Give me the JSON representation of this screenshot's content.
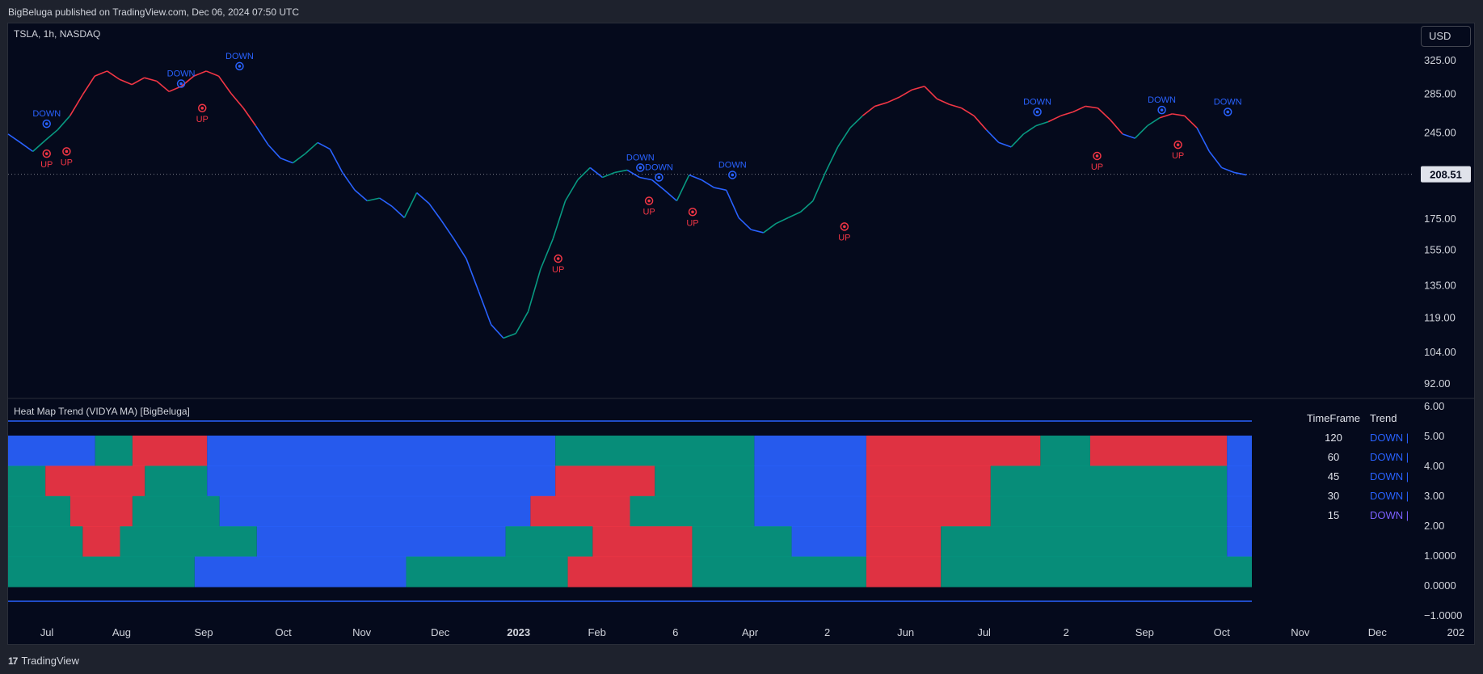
{
  "header": {
    "published": "BigBeluga published on TradingView.com, Dec 06, 2024 07:50 UTC"
  },
  "symbol_label": "TSLA, 1h, NASDAQ",
  "currency_button": "USD",
  "indicator_label": "Heat Map Trend (VIDYA MA) [BigBeluga]",
  "footer": {
    "brand": "TradingView",
    "logo_mark": "17"
  },
  "colors": {
    "up": "#f23645",
    "down": "#2962ff",
    "teal": "#089981",
    "background": "#050a1c",
    "panel": "#1e222d"
  },
  "trend_table": {
    "header_timeframe": "TimeFrame",
    "header_trend": "Trend",
    "rows": [
      {
        "timeframe": "120",
        "trend": "DOWN",
        "color": "#2962ff"
      },
      {
        "timeframe": "60",
        "trend": "DOWN",
        "color": "#2962ff"
      },
      {
        "timeframe": "45",
        "trend": "DOWN",
        "color": "#2962ff"
      },
      {
        "timeframe": "30",
        "trend": "DOWN",
        "color": "#2962ff"
      },
      {
        "timeframe": "15",
        "trend": "DOWN",
        "color": "#7b61ff"
      }
    ]
  },
  "chart_data": [
    {
      "type": "line",
      "title": "TSLA, 1h, NASDAQ",
      "y_ticks": [
        325.0,
        285.0,
        245.0,
        208.51,
        175.0,
        155.0,
        135.0,
        119.0,
        104.0,
        92.0
      ],
      "y_tick_labels": [
        "325.00",
        "285.00",
        "245.00",
        "208.51",
        "175.00",
        "155.00",
        "135.00",
        "119.00",
        "104.00",
        "92.00"
      ],
      "last_price": 208.51,
      "last_price_label": "208.51",
      "x_tick_labels": [
        "Jul",
        "Aug",
        "Sep",
        "Oct",
        "Nov",
        "Dec",
        "2023",
        "Feb",
        "6",
        "Apr",
        "2",
        "Jun",
        "Jul",
        "2",
        "Sep",
        "Oct",
        "Nov",
        "Dec",
        "202"
      ],
      "x_tick_positions": [
        0.013,
        0.073,
        0.139,
        0.203,
        0.266,
        0.329,
        0.392,
        0.455,
        0.518,
        0.578,
        0.64,
        0.703,
        0.766,
        0.832,
        0.895,
        0.957,
        1.02,
        1.082,
        1.145
      ],
      "series": [
        {
          "x": [
            0,
            0.01,
            0.02,
            0.03,
            0.04,
            0.05,
            0.06,
            0.07,
            0.08,
            0.09,
            0.1,
            0.11,
            0.12,
            0.13,
            0.14,
            0.15,
            0.16,
            0.17,
            0.18,
            0.19,
            0.2,
            0.21,
            0.22,
            0.23,
            0.24,
            0.25,
            0.26,
            0.27,
            0.28,
            0.29,
            0.3,
            0.31,
            0.32,
            0.33,
            0.34,
            0.35,
            0.36,
            0.37,
            0.38,
            0.39,
            0.4,
            0.41,
            0.42,
            0.43,
            0.44,
            0.45,
            0.46,
            0.47,
            0.48,
            0.49,
            0.5,
            0.51,
            0.52,
            0.53,
            0.54,
            0.55,
            0.56,
            0.57,
            0.58,
            0.59,
            0.6,
            0.61,
            0.62,
            0.63,
            0.64,
            0.65,
            0.66,
            0.67,
            0.68,
            0.69,
            0.7,
            0.71,
            0.72,
            0.73,
            0.74,
            0.75,
            0.76,
            0.77,
            0.78,
            0.79,
            0.8,
            0.81,
            0.82,
            0.83,
            0.84,
            0.85,
            0.86,
            0.87,
            0.88,
            0.89,
            0.9,
            0.91,
            0.92,
            0.93,
            0.94,
            0.95,
            0.96,
            0.97,
            0.98,
            0.99,
            1.0
          ],
          "y": [
            244,
            236,
            228,
            238,
            248,
            262,
            284,
            306,
            312,
            302,
            296,
            304,
            300,
            288,
            294,
            306,
            312,
            306,
            286,
            270,
            252,
            234,
            222,
            218,
            226,
            236,
            230,
            210,
            196,
            188,
            190,
            184,
            176,
            194,
            186,
            174,
            162,
            150,
            132,
            116,
            110,
            112,
            122,
            144,
            162,
            188,
            204,
            214,
            206,
            210,
            212,
            206,
            204,
            196,
            188,
            208,
            204,
            198,
            196,
            176,
            168,
            166,
            172,
            176,
            180,
            188,
            210,
            232,
            250,
            262,
            272,
            276,
            282,
            290,
            294,
            280,
            274,
            270,
            262,
            248,
            236,
            232,
            244,
            252,
            256,
            262,
            266,
            272,
            270,
            258,
            244,
            240,
            252,
            260,
            264,
            262,
            250,
            228,
            214,
            210,
            208
          ]
        }
      ],
      "annotations": [
        {
          "text": "DOWN",
          "x": 0.031,
          "y": 254,
          "color": "#2962ff",
          "kind": "down"
        },
        {
          "text": "UP",
          "x": 0.031,
          "y": 226,
          "color": "#f23645",
          "kind": "up"
        },
        {
          "text": "UP",
          "x": 0.047,
          "y": 228,
          "color": "#f23645",
          "kind": "up"
        },
        {
          "text": "DOWN",
          "x": 0.139,
          "y": 297,
          "color": "#2962ff",
          "kind": "down"
        },
        {
          "text": "UP",
          "x": 0.156,
          "y": 270,
          "color": "#f23645",
          "kind": "up"
        },
        {
          "text": "DOWN",
          "x": 0.186,
          "y": 318,
          "color": "#2962ff",
          "kind": "down"
        },
        {
          "text": "UP",
          "x": 0.442,
          "y": 150,
          "color": "#f23645",
          "kind": "up"
        },
        {
          "text": "DOWN",
          "x": 0.508,
          "y": 214,
          "color": "#2962ff",
          "kind": "down"
        },
        {
          "text": "DOWN",
          "x": 0.523,
          "y": 206,
          "color": "#2962ff",
          "kind": "down"
        },
        {
          "text": "UP",
          "x": 0.515,
          "y": 188,
          "color": "#f23645",
          "kind": "up"
        },
        {
          "text": "UP",
          "x": 0.55,
          "y": 180,
          "color": "#f23645",
          "kind": "up"
        },
        {
          "text": "DOWN",
          "x": 0.582,
          "y": 208,
          "color": "#2962ff",
          "kind": "down"
        },
        {
          "text": "UP",
          "x": 0.672,
          "y": 170,
          "color": "#f23645",
          "kind": "up"
        },
        {
          "text": "DOWN",
          "x": 0.827,
          "y": 266,
          "color": "#2962ff",
          "kind": "down"
        },
        {
          "text": "UP",
          "x": 0.875,
          "y": 224,
          "color": "#f23645",
          "kind": "up"
        },
        {
          "text": "DOWN",
          "x": 0.927,
          "y": 268,
          "color": "#2962ff",
          "kind": "down"
        },
        {
          "text": "UP",
          "x": 0.94,
          "y": 234,
          "color": "#f23645",
          "kind": "up"
        },
        {
          "text": "DOWN",
          "x": 0.98,
          "y": 266,
          "color": "#2962ff",
          "kind": "down"
        }
      ]
    },
    {
      "type": "heatmap",
      "title": "Heat Map Trend (VIDYA MA) [BigBeluga]",
      "y_ticks": [
        6.0,
        5.0,
        4.0,
        3.0,
        2.0,
        1.0,
        0.0,
        -1.0
      ],
      "y_tick_labels": [
        "6.00",
        "5.00",
        "4.00",
        "3.00",
        "2.00",
        "1.0000",
        "0.0000",
        "−1.0000"
      ],
      "rows": [
        {
          "name": "120",
          "segments": [
            [
              0,
              0.07,
              "#2962ff"
            ],
            [
              0.07,
              0.1,
              "#089981"
            ],
            [
              0.1,
              0.16,
              "#f23645"
            ],
            [
              0.16,
              0.44,
              "#2962ff"
            ],
            [
              0.44,
              0.6,
              "#089981"
            ],
            [
              0.6,
              0.69,
              "#2962ff"
            ],
            [
              0.69,
              0.83,
              "#f23645"
            ],
            [
              0.83,
              0.87,
              "#089981"
            ],
            [
              0.87,
              0.98,
              "#f23645"
            ],
            [
              0.98,
              1.0,
              "#2962ff"
            ]
          ]
        },
        {
          "name": "60",
          "segments": [
            [
              0,
              0.03,
              "#089981"
            ],
            [
              0.03,
              0.11,
              "#f23645"
            ],
            [
              0.11,
              0.16,
              "#089981"
            ],
            [
              0.16,
              0.44,
              "#2962ff"
            ],
            [
              0.44,
              0.52,
              "#f23645"
            ],
            [
              0.52,
              0.6,
              "#089981"
            ],
            [
              0.6,
              0.69,
              "#2962ff"
            ],
            [
              0.69,
              0.79,
              "#f23645"
            ],
            [
              0.79,
              0.98,
              "#089981"
            ],
            [
              0.98,
              1.0,
              "#2962ff"
            ]
          ]
        },
        {
          "name": "45",
          "segments": [
            [
              0,
              0.05,
              "#089981"
            ],
            [
              0.05,
              0.1,
              "#f23645"
            ],
            [
              0.1,
              0.17,
              "#089981"
            ],
            [
              0.17,
              0.42,
              "#2962ff"
            ],
            [
              0.42,
              0.5,
              "#f23645"
            ],
            [
              0.5,
              0.6,
              "#089981"
            ],
            [
              0.6,
              0.69,
              "#2962ff"
            ],
            [
              0.69,
              0.79,
              "#f23645"
            ],
            [
              0.79,
              0.98,
              "#089981"
            ],
            [
              0.98,
              1.0,
              "#2962ff"
            ]
          ]
        },
        {
          "name": "30",
          "segments": [
            [
              0,
              0.06,
              "#089981"
            ],
            [
              0.06,
              0.09,
              "#f23645"
            ],
            [
              0.09,
              0.2,
              "#089981"
            ],
            [
              0.2,
              0.4,
              "#2962ff"
            ],
            [
              0.4,
              0.47,
              "#089981"
            ],
            [
              0.47,
              0.55,
              "#f23645"
            ],
            [
              0.55,
              0.63,
              "#089981"
            ],
            [
              0.63,
              0.69,
              "#2962ff"
            ],
            [
              0.69,
              0.75,
              "#f23645"
            ],
            [
              0.75,
              0.98,
              "#089981"
            ],
            [
              0.98,
              1.0,
              "#2962ff"
            ]
          ]
        },
        {
          "name": "15",
          "segments": [
            [
              0,
              0.15,
              "#089981"
            ],
            [
              0.15,
              0.32,
              "#2962ff"
            ],
            [
              0.32,
              0.45,
              "#089981"
            ],
            [
              0.45,
              0.55,
              "#f23645"
            ],
            [
              0.55,
              0.69,
              "#089981"
            ],
            [
              0.69,
              0.75,
              "#f23645"
            ],
            [
              0.75,
              1.0,
              "#089981"
            ]
          ]
        }
      ]
    }
  ]
}
